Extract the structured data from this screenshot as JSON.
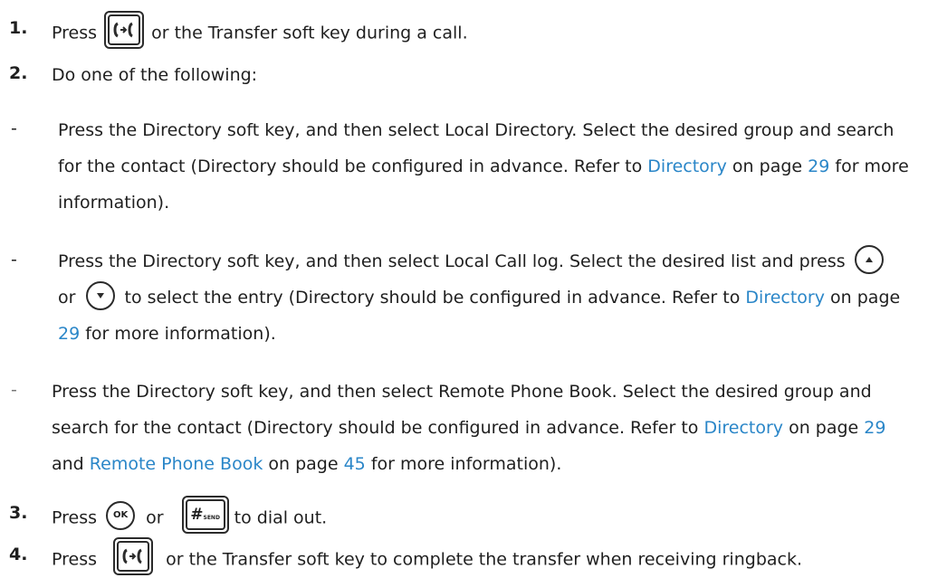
{
  "steps": {
    "s1": {
      "num": "1.",
      "a": "Press",
      "b": "or the Transfer soft key during a call."
    },
    "s2": {
      "num": "2.",
      "text": "Do one of the following:"
    },
    "s3": {
      "num": "3.",
      "a": "Press",
      "b": "or",
      "c": "to dial out."
    },
    "s4": {
      "num": "4.",
      "a": "Press",
      "b": "or the Transfer soft key to complete the transfer when receiving ringback."
    }
  },
  "dash": "-",
  "b1": {
    "l1": "Press the Directory soft key, and then select Local Directory. Select the desired group and search",
    "l2a": "for the contact (Directory should be configured in advance. Refer to",
    "link": "Directory",
    "l2b": "on page",
    "page": "29",
    "l2c": "for more",
    "l3": "information)."
  },
  "b2": {
    "l1": "Press the Directory soft key, and then select Local Call log. Select the desired list and press",
    "l2a": "or",
    "l2b": "to select the entry (Directory should be configured in advance. Refer to",
    "link": "Directory",
    "l2c": "on page",
    "page": "29",
    "l3": "for more information)."
  },
  "b3": {
    "l1": "Press the Directory soft key, and then select Remote Phone Book. Select the desired group and",
    "l2a": "search for the contact (Directory should be configured in advance. Refer to",
    "link1": "Directory",
    "l2b": "on page",
    "page1": "29",
    "l3a": "and",
    "link2": "Remote Phone Book",
    "l3b": "on page",
    "page2": "45",
    "l3c": "for more information)."
  },
  "icons": {
    "transfer": "transfer-key-icon",
    "ok": "OK",
    "send": "#",
    "send_sub": "SEND",
    "up": "up-navigation-icon",
    "down": "down-navigation-icon"
  },
  "colors": {
    "link": "#2a86c8",
    "text": "#1f1f1f"
  }
}
